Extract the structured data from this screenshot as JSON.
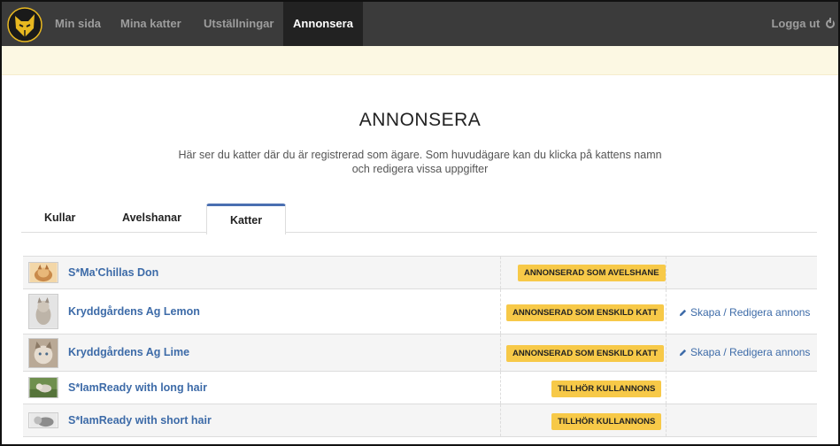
{
  "nav": {
    "items": [
      {
        "label": "Min sida"
      },
      {
        "label": "Mina katter"
      },
      {
        "label": "Utställningar"
      },
      {
        "label": "Annonsera"
      }
    ],
    "logout_label": "Logga ut"
  },
  "page": {
    "title": "ANNONSERA",
    "description": "Här ser du katter där du är registrerad som ägare. Som huvudägare kan du klicka på kattens namn och redigera vissa uppgifter"
  },
  "tabs": [
    {
      "label": "Kullar"
    },
    {
      "label": "Avelshanar"
    },
    {
      "label": "Katter"
    }
  ],
  "cats": [
    {
      "name": "S*Ma'Chillas Don",
      "status": "ANNONSERAD SOM AVELSHANE",
      "action": ""
    },
    {
      "name": "Kryddgårdens Ag Lemon",
      "status": "ANNONSERAD SOM ENSKILD KATT",
      "action": "Skapa / Redigera annons"
    },
    {
      "name": "Kryddgårdens Ag Lime",
      "status": "ANNONSERAD SOM ENSKILD KATT",
      "action": "Skapa / Redigera annons"
    },
    {
      "name": "S*IamReady with long hair",
      "status": "TILLHÖR KULLANNONS",
      "action": ""
    },
    {
      "name": "S*IamReady with short hair",
      "status": "TILLHÖR KULLANNONS",
      "action": ""
    }
  ],
  "colors": {
    "navbar": "#3b3b3b",
    "navbar_active": "#222222",
    "notice": "#fcf8e3",
    "badge": "#f7c948",
    "link": "#3d6ba8",
    "tab_accent": "#4a6fb1"
  }
}
